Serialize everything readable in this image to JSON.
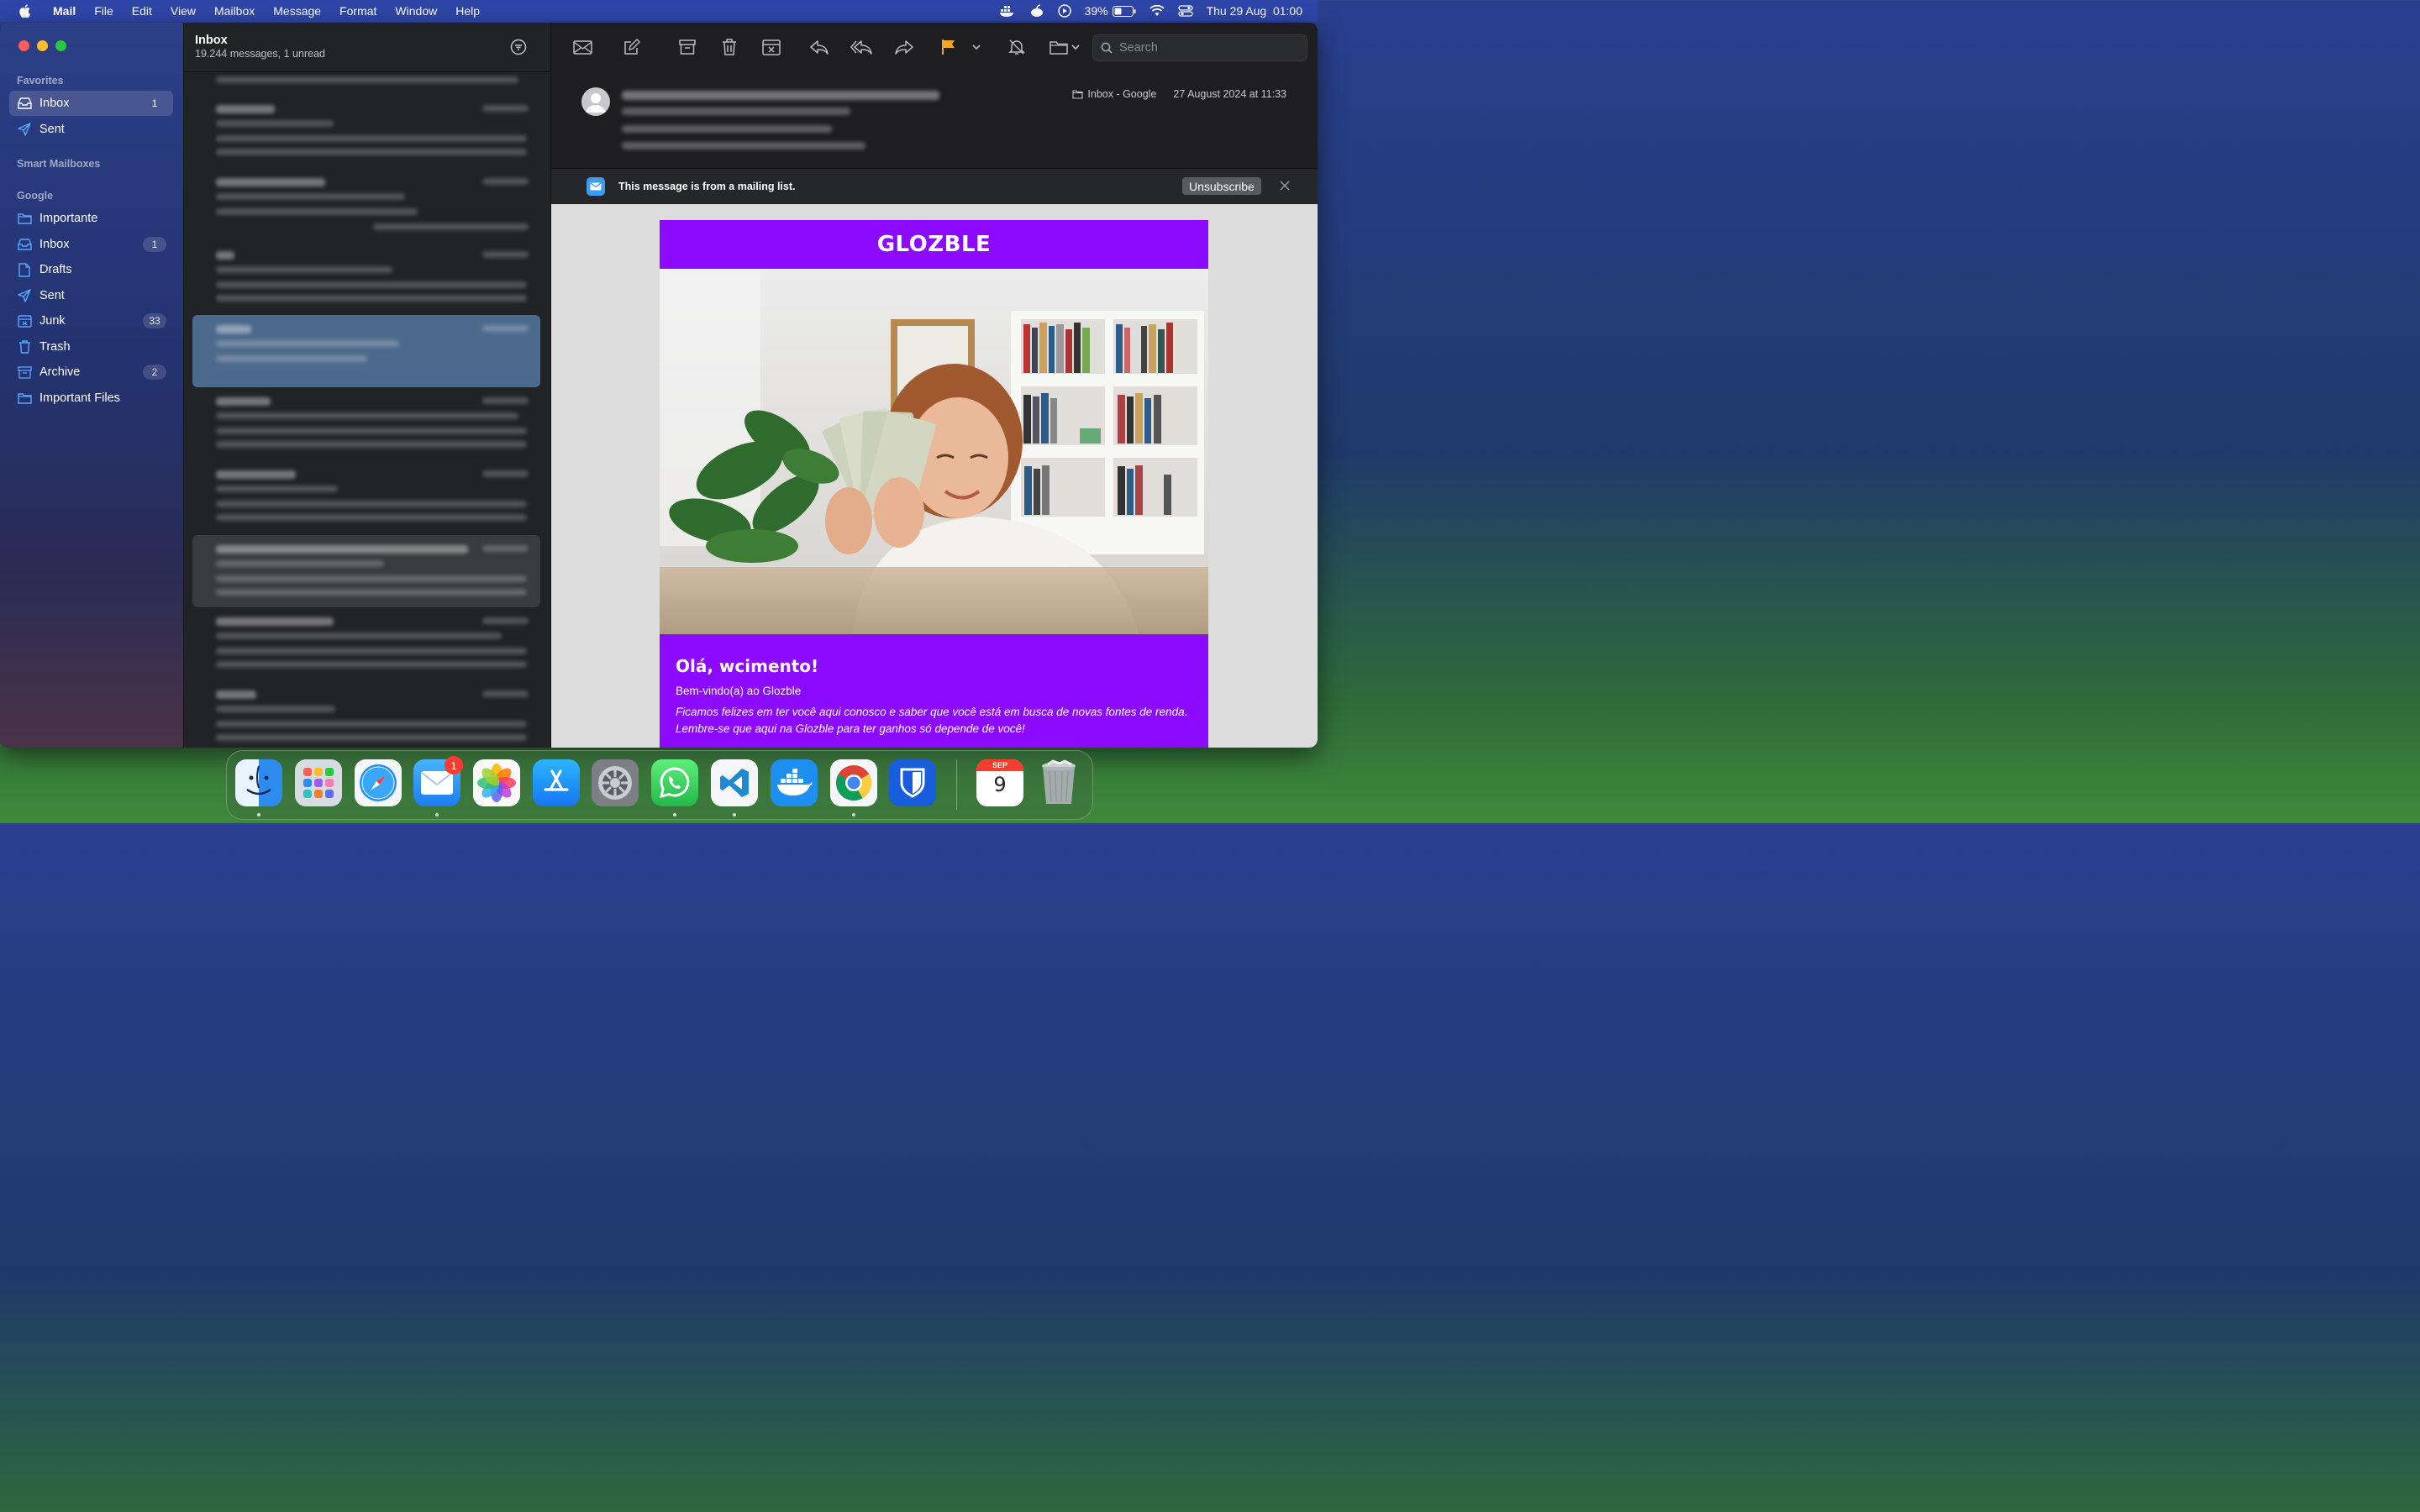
{
  "menubar": {
    "app": "Mail",
    "items": [
      "File",
      "Edit",
      "View",
      "Mailbox",
      "Message",
      "Format",
      "Window",
      "Help"
    ],
    "battery": "39%",
    "datetime": "Thu 29 Aug  01:00"
  },
  "sidebar": {
    "favorites_label": "Favorites",
    "favorites": [
      {
        "label": "Inbox",
        "badge": "1",
        "icon": "inbox-icon"
      },
      {
        "label": "Sent",
        "icon": "paperplane-icon"
      }
    ],
    "smart_label": "Smart Mailboxes",
    "google_label": "Google",
    "google": [
      {
        "label": "Importante",
        "icon": "folder-icon"
      },
      {
        "label": "Inbox",
        "badge": "1",
        "icon": "inbox-icon"
      },
      {
        "label": "Drafts",
        "icon": "document-icon"
      },
      {
        "label": "Sent",
        "icon": "paperplane-icon"
      },
      {
        "label": "Junk",
        "badge": "33",
        "icon": "junk-icon"
      },
      {
        "label": "Trash",
        "icon": "trash-icon"
      },
      {
        "label": "Archive",
        "badge": "2",
        "icon": "archive-icon"
      },
      {
        "label": "Important Files",
        "icon": "folder-icon"
      }
    ]
  },
  "list": {
    "title": "Inbox",
    "subtitle": "19.244 messages, 1 unread"
  },
  "toolbar": {
    "search_placeholder": "Search",
    "accent": "#f5a623"
  },
  "message": {
    "mailbox": "Inbox - Google",
    "date": "27 August 2024 at 11:33",
    "banner_text": "This message is from a mailing list.",
    "unsubscribe": "Unsubscribe"
  },
  "email": {
    "brand": "GLOZBLE",
    "heading": "Olá, wcimento!",
    "subheading": "Bem-vindo(a) ao Glozble",
    "paragraph": "Ficamos felizes em ter você aqui conosco e saber que você está em busca de novas fontes de renda. Lembre-se que aqui na Glozble para ter ganhos só depende de você!",
    "brand_color": "#8c0aff"
  },
  "dock": {
    "mail_badge": "1",
    "calendar_month": "SEP",
    "calendar_day": "9",
    "apps": [
      "Finder",
      "Launchpad",
      "Safari",
      "Mail",
      "Photos",
      "App Store",
      "System Settings",
      "WhatsApp",
      "Visual Studio Code",
      "Docker",
      "Chrome",
      "Bitwarden",
      "Calendar",
      "Trash"
    ]
  }
}
